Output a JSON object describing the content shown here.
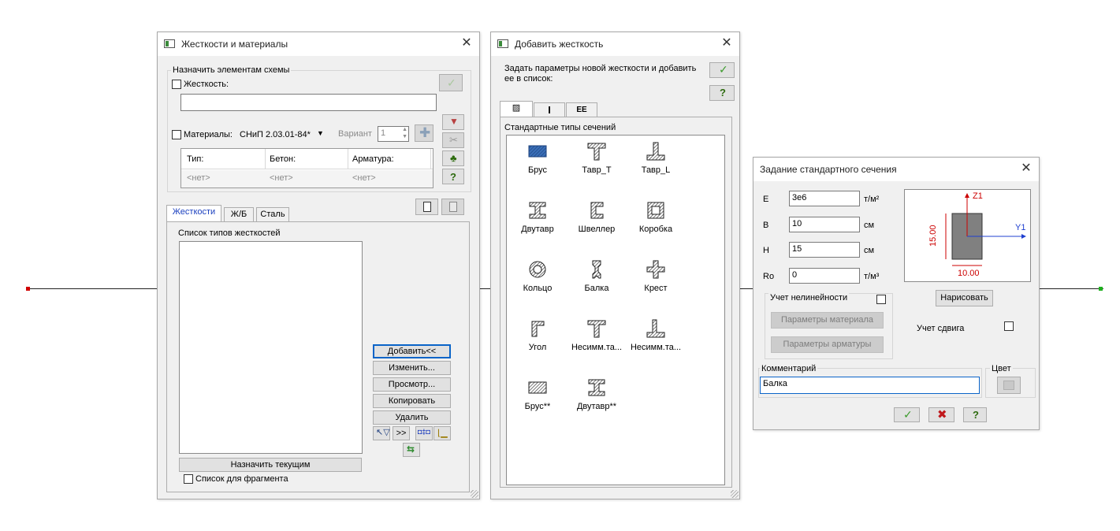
{
  "colors": {
    "accent": "#1a3fbf",
    "ok": "#3a9a2a",
    "cancel": "#c0181c",
    "help": "#2d6b0e",
    "node_start": "#d00000",
    "node_end": "#1fb01f",
    "section_fill": "#808080",
    "axis_z": "#cc0000",
    "axis_y": "#2040d0"
  },
  "win1": {
    "title": "Жесткости и материалы",
    "group_title": "Назначить элементам схемы",
    "stiffness_label": "Жесткость:",
    "stiffness_value": "",
    "materials_label": "Материалы:",
    "materials_norm": "СНиП 2.03.01-84*",
    "variant_label": "Вариант",
    "variant_value": "1",
    "table_headers": [
      "Тип:",
      "Бетон:",
      "Арматура:"
    ],
    "table_values": [
      "<нет>",
      "<нет>",
      "<нет>"
    ],
    "tabs": [
      "Жесткости",
      "Ж/Б",
      "Сталь"
    ],
    "list_caption": "Список типов жесткостей",
    "buttons": {
      "add": "Добавить<<",
      "edit": "Изменить...",
      "view": "Просмотр...",
      "copy": "Копировать",
      "delete": "Удалить",
      "assign": "Назначить текущим",
      "more": ">>"
    },
    "fragment_label": "Список для фрагмента"
  },
  "win2": {
    "title": "Добавить жесткость",
    "instruction": "Задать параметры новой жесткости и добавить ее в список:",
    "tabs": [
      "▨",
      "I",
      "EE"
    ],
    "panel_caption": "Стандартные типы сечений",
    "sections": [
      {
        "label": "Брус",
        "icon": "brus-icon"
      },
      {
        "label": "Тавр_Т",
        "icon": "tavr-t-icon"
      },
      {
        "label": "Тавр_L",
        "icon": "tavr-l-icon"
      },
      {
        "label": "Двутавр",
        "icon": "dvutavr-icon"
      },
      {
        "label": "Швеллер",
        "icon": "shveller-icon"
      },
      {
        "label": "Коробка",
        "icon": "korobka-icon"
      },
      {
        "label": "Кольцо",
        "icon": "koltso-icon"
      },
      {
        "label": "Балка",
        "icon": "balka-icon"
      },
      {
        "label": "Крест",
        "icon": "krest-icon"
      },
      {
        "label": "Угол",
        "icon": "ugol-icon"
      },
      {
        "label": "Несимм.та...",
        "icon": "nesimm-t-icon"
      },
      {
        "label": "Несимм.та...",
        "icon": "nesimm-l-icon"
      },
      {
        "label": "Брус**",
        "icon": "brus2-icon"
      },
      {
        "label": "Двутавр**",
        "icon": "dvutavr2-icon"
      }
    ]
  },
  "win3": {
    "title": "Задание стандартного сечения",
    "params": [
      {
        "name": "E",
        "value": "3e6",
        "unit": "т/м²"
      },
      {
        "name": "B",
        "value": "10",
        "unit": "см"
      },
      {
        "name": "H",
        "value": "15",
        "unit": "см"
      },
      {
        "name": "Ro",
        "value": "0",
        "unit": "т/м³"
      }
    ],
    "nonlinearity_label": "Учет нелинейности",
    "material_params": "Параметры материала",
    "rebar_params": "Параметры арматуры",
    "draw_button": "Нарисовать",
    "shear_label": "Учет сдвига",
    "comment_label": "Комментарий",
    "comment_value": "Балка",
    "color_label": "Цвет",
    "preview": {
      "z_label": "Z1",
      "y_label": "Y1",
      "height_label": "15.00",
      "width_label": "10.00"
    }
  }
}
